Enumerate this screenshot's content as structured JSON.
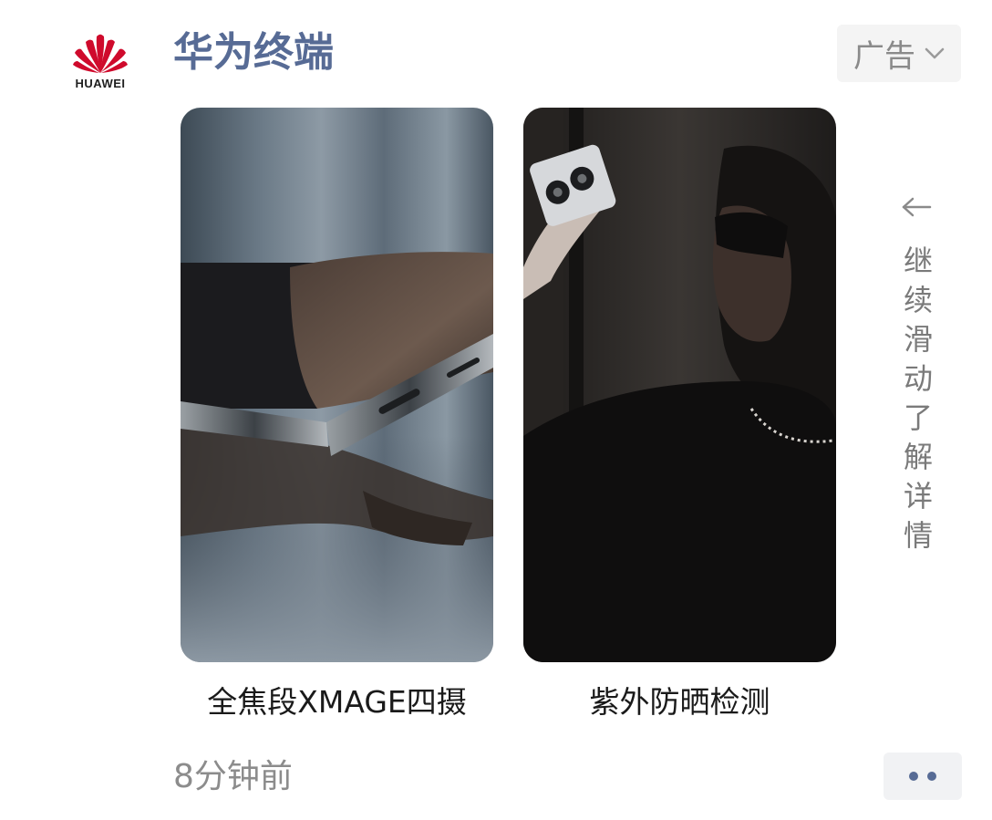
{
  "account": {
    "logo_text": "HUAWEI",
    "name": "华为终端",
    "name_color": "#576b95",
    "logo_color": "#cf0a2c"
  },
  "ad_tag": {
    "label": "广告",
    "icon": "chevron-down-icon"
  },
  "cards": [
    {
      "caption": "全焦段XMAGE四摄",
      "image": "foldable-phone-hinge-photo"
    },
    {
      "caption": "紫外防晒检测",
      "image": "woman-holding-phone-dark-photo"
    }
  ],
  "swipe_hint": {
    "icon": "arrow-left-icon",
    "text": "继续滑动了解详情"
  },
  "footer": {
    "timestamp": "8分钟前",
    "more_icon": "two-dots-icon"
  }
}
